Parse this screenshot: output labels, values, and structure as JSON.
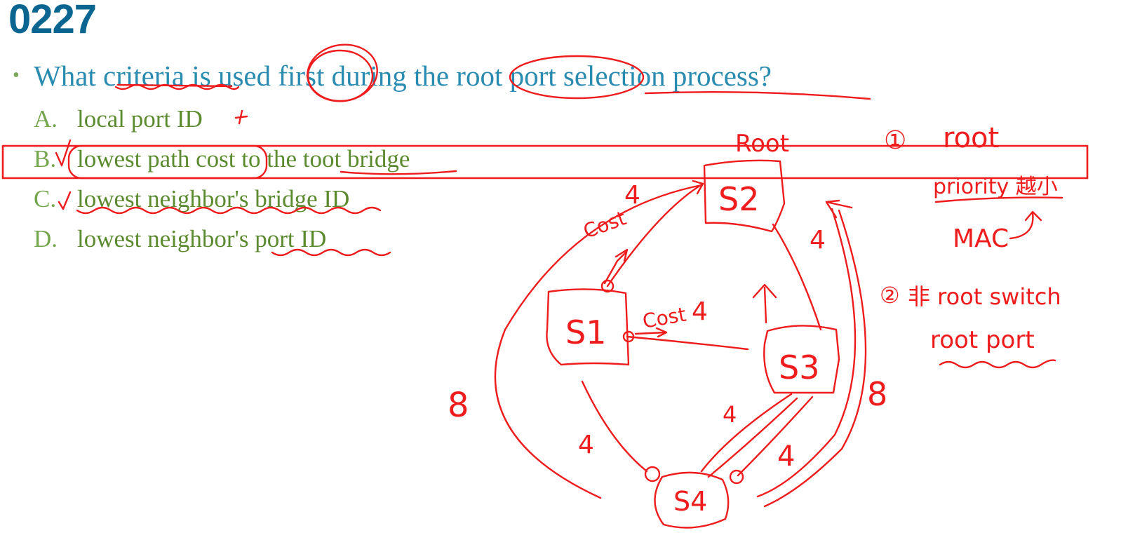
{
  "slide": {
    "number": "0227"
  },
  "question": {
    "text": "What criteria is used first during the root port selection process?"
  },
  "options": [
    {
      "letter": "A.",
      "text": "local port ID"
    },
    {
      "letter": "B.",
      "text": "lowest path cost to the toot bridge"
    },
    {
      "letter": "C.",
      "text": "lowest neighbor's bridge ID"
    },
    {
      "letter": "D.",
      "text": "lowest neighbor's port ID"
    }
  ],
  "annotations": {
    "root_label": "Root",
    "switches": {
      "s1": "S1",
      "s2": "S2",
      "s3": "S3",
      "s4": "S4"
    },
    "link_costs": {
      "s2_s1": "4",
      "s2_s3": "4",
      "s1_s3": "4",
      "s1_s4": "4",
      "s3_s4_a": "4",
      "s3_s4_b": "4",
      "left_path": "8",
      "right_path": "8"
    },
    "cost_label_1": "Cost",
    "cost_label_2": "Cost",
    "notes": [
      {
        "marker": "①",
        "text": "root"
      },
      {
        "marker": "",
        "text": "priority 越小"
      },
      {
        "marker": "",
        "text": "MAC"
      },
      {
        "marker": "②",
        "text": "非 root switch"
      },
      {
        "marker": "",
        "text": "root port"
      }
    ],
    "option_a_mark": "+"
  },
  "colors": {
    "slide_number": "#0a6591",
    "question": "#2a8bb0",
    "bullet": "#7fa95a",
    "option_letter": "#74a64e",
    "option_text": "#5b8a2f",
    "ink": "#ee1c1c"
  }
}
